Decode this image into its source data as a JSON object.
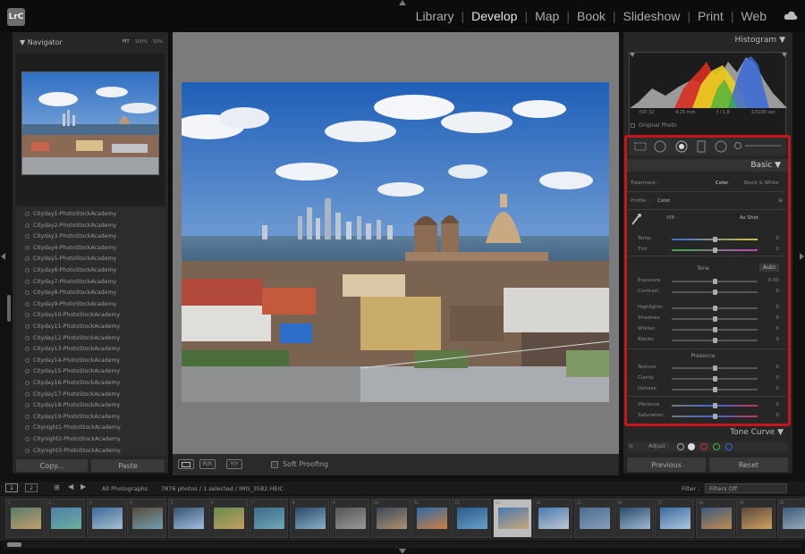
{
  "app": {
    "logo": "LrC"
  },
  "modules": [
    {
      "label": "Library",
      "active": false
    },
    {
      "label": "Develop",
      "active": true
    },
    {
      "label": "Map",
      "active": false
    },
    {
      "label": "Book",
      "active": false
    },
    {
      "label": "Slideshow",
      "active": false
    },
    {
      "label": "Print",
      "active": false
    },
    {
      "label": "Web",
      "active": false
    }
  ],
  "navigator": {
    "title": "Navigator",
    "zoom_options": [
      "FIT",
      "100%",
      "50%"
    ]
  },
  "presets": [
    "Cityday1-PhotoStockAcademy",
    "Cityday2-PhotoStockAcademy",
    "Cityday3-PhotoStockAcademy",
    "Cityday4-PhotoStockAcademy",
    "Cityday5-PhotoStockAcademy",
    "Cityday6-PhotoStockAcademy",
    "Cityday7-PhotoStockAcademy",
    "Cityday8-PhotoStockAcademy",
    "Cityday9-PhotoStockAcademy",
    "Cityday10-PhotoStockAcademy",
    "Cityday11-PhotoStockAcademy",
    "Cityday12-PhotoStockAcademy",
    "Cityday13-PhotoStockAcademy",
    "Cityday14-PhotoStockAcademy",
    "Cityday15-PhotoStockAcademy",
    "Cityday16-PhotoStockAcademy",
    "Cityday17-PhotoStockAcademy",
    "Cityday18-PhotoStockAcademy",
    "Cityday19-PhotoStockAcademy",
    "Citynight1-PhotoStockAcademy",
    "Citynight2-PhotoStockAcademy",
    "Citynight3-PhotoStockAcademy"
  ],
  "left_buttons": {
    "copy": "Copy...",
    "paste": "Paste"
  },
  "toolbar": {
    "soft_proofing": "Soft Proofing"
  },
  "histogram": {
    "title": "Histogram",
    "iso": "ISO 32",
    "focal": "4.25 mm",
    "aperture": "ƒ / 1.8",
    "shutter": "1/3100 sec",
    "original_photo": "Original Photo"
  },
  "basic": {
    "title": "Basic",
    "treatment_label": "Treatment :",
    "treatment_color": "Color",
    "treatment_bw": "Black & White",
    "profile_label": "Profile :",
    "profile_value": "Color",
    "wb_label": "WB :",
    "wb_value": "As Shot",
    "tone_label": "Tone",
    "auto_label": "Auto",
    "presence_label": "Presence",
    "sliders": [
      {
        "label": "Temp",
        "value": "0",
        "pos": 0.5
      },
      {
        "label": "Tint",
        "value": "0",
        "pos": 0.5
      },
      {
        "label": "Exposure",
        "value": "0.00",
        "pos": 0.5
      },
      {
        "label": "Contrast",
        "value": "0",
        "pos": 0.5
      },
      {
        "label": "Highlights",
        "value": "0",
        "pos": 0.5
      },
      {
        "label": "Shadows",
        "value": "0",
        "pos": 0.5
      },
      {
        "label": "Whites",
        "value": "0",
        "pos": 0.5
      },
      {
        "label": "Blacks",
        "value": "0",
        "pos": 0.5
      },
      {
        "label": "Texture",
        "value": "0",
        "pos": 0.5
      },
      {
        "label": "Clarity",
        "value": "0",
        "pos": 0.5
      },
      {
        "label": "Dehaze",
        "value": "0",
        "pos": 0.5
      },
      {
        "label": "Vibrance",
        "value": "0",
        "pos": 0.5
      },
      {
        "label": "Saturation",
        "value": "0",
        "pos": 0.5
      }
    ]
  },
  "tone_curve": {
    "title": "Tone Curve",
    "adjust": "Adjust :"
  },
  "right_buttons": {
    "previous": "Previous",
    "reset": "Reset"
  },
  "filmstrip_bar": {
    "page1": "1",
    "page2": "2",
    "source": "All Photographs",
    "count": "7876 photos / 1 selected / IMG_3582.HEIC",
    "filter_label": "Filter :",
    "filter_value": "Filters Off"
  },
  "filmstrip": {
    "numbers": [
      "1",
      "2",
      "3",
      "4",
      "5",
      "6",
      "7",
      "8",
      "9",
      "10",
      "11",
      "12",
      "13",
      "14",
      "15",
      "16",
      "17",
      "18",
      "19",
      "20"
    ],
    "selected_index": 12
  }
}
